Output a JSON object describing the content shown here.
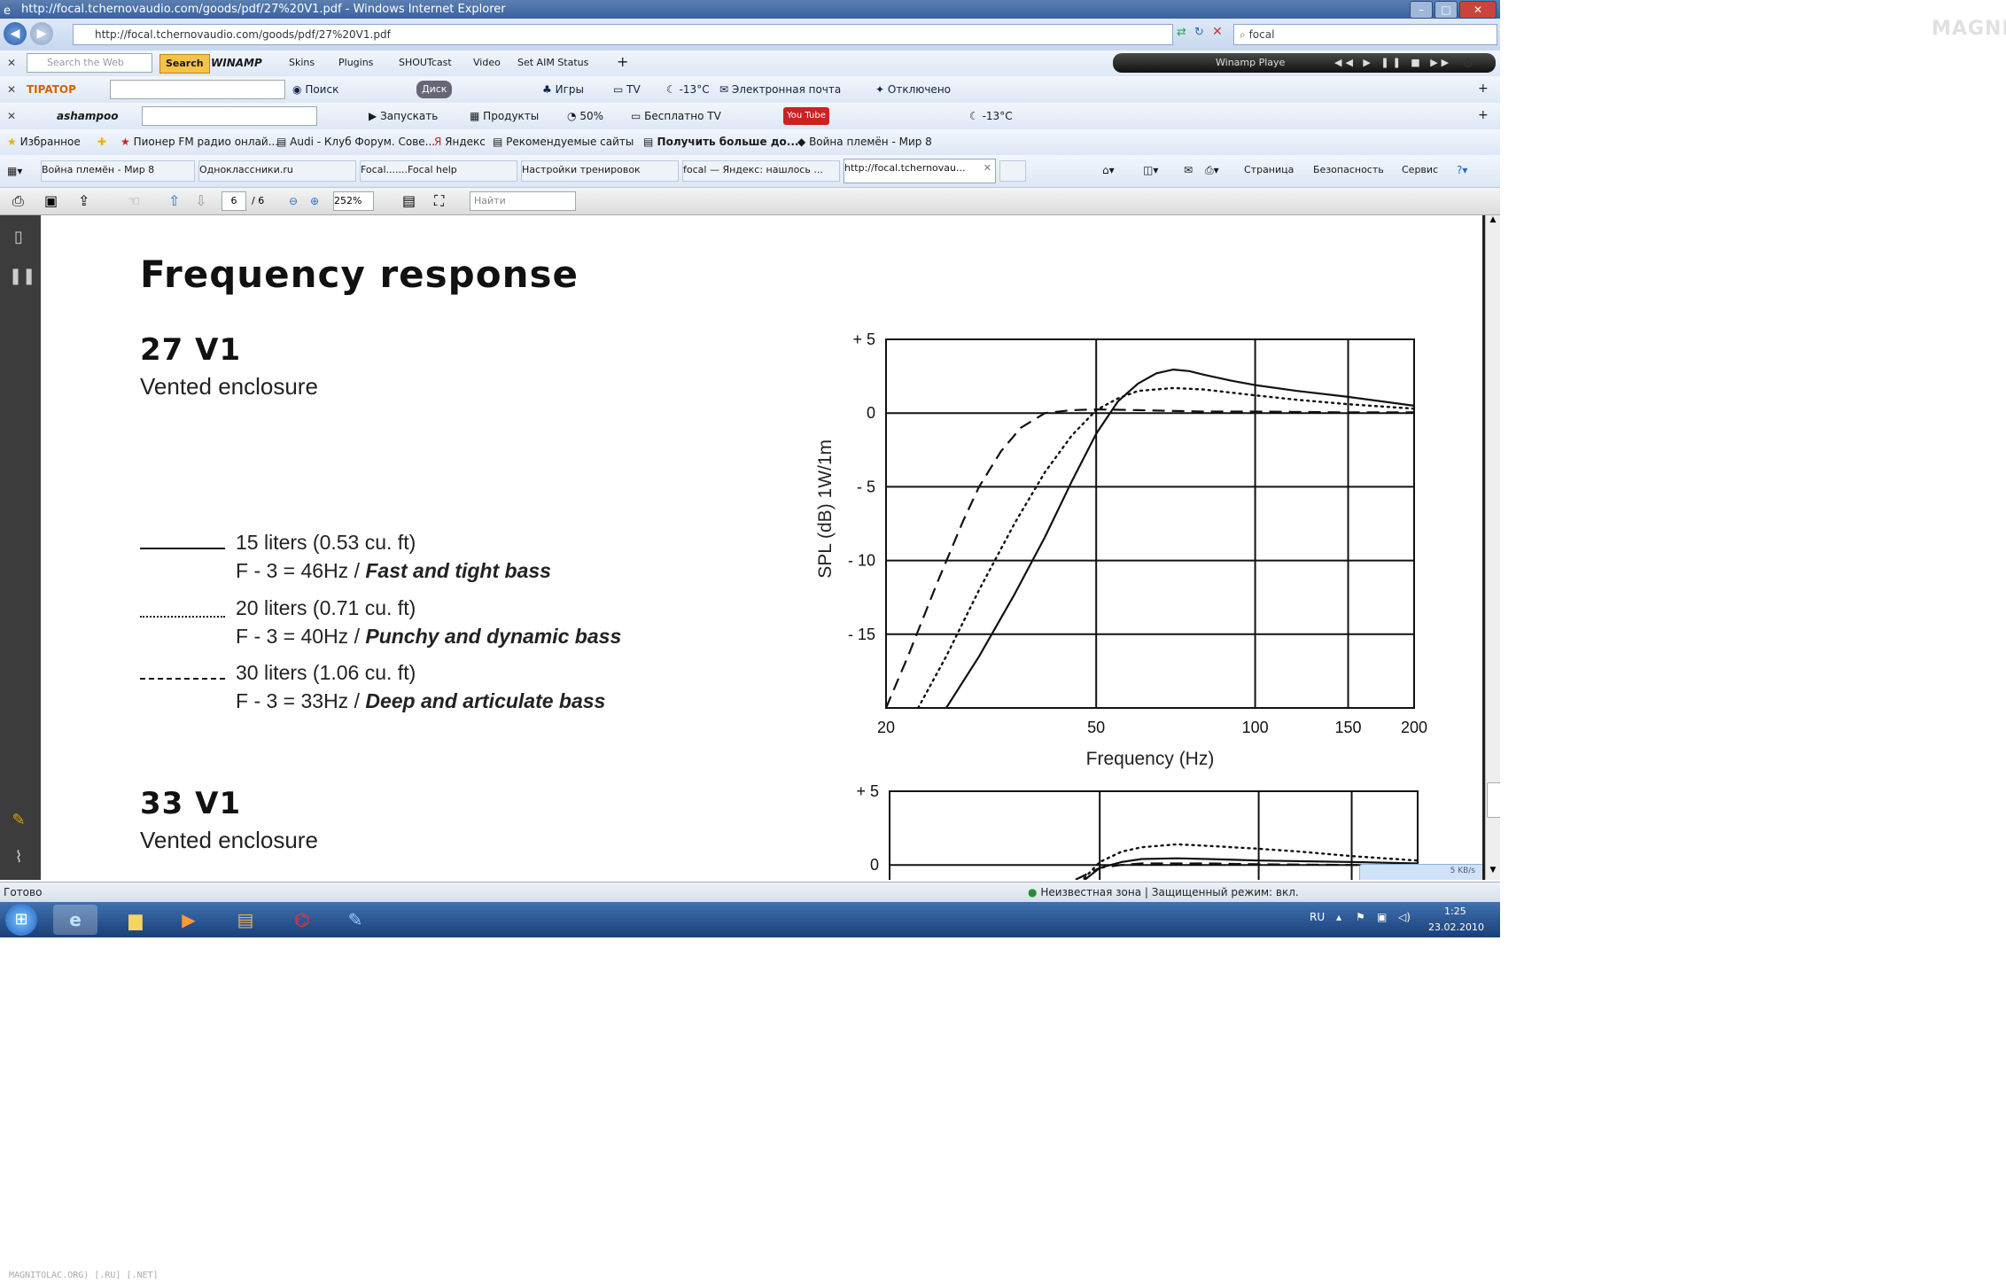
{
  "window": {
    "title": "http://focal.tchernovaudio.com/goods/pdf/27%20V1.pdf - Windows Internet Explorer"
  },
  "address": {
    "url": "http://focal.tchernovaudio.com/goods/pdf/27%20V1.pdf",
    "search": "focal"
  },
  "toolbar1": {
    "search_placeholder": "Search the Web",
    "search_button": "Search",
    "brand": "WINAMP",
    "items": [
      "Skins",
      "Plugins",
      "SHOUTcast",
      "Video",
      "Set AIM Status"
    ],
    "player": "Winamp Playe"
  },
  "toolbar2": {
    "brand": "TIPATOP",
    "search": "Поиск",
    "disk": "Диск",
    "games": "Игры",
    "tv": "TV",
    "weather": "-13°C",
    "mail": "Электронная почта",
    "status": "Отключено"
  },
  "toolbar3": {
    "brand": "ashampoo",
    "launch": "Запускать",
    "products": "Продукты",
    "percent": "50%",
    "free_tv": "Бесплатно TV",
    "weather": "-13°C"
  },
  "favorites": {
    "label": "Избранное",
    "items": [
      "Пионер FM радио онлай...",
      "Audi - Клуб Форум. Сове...",
      "Яндекс",
      "Рекомендуемые сайты",
      "Получить больше до...",
      "Война племён - Мир 8"
    ]
  },
  "tabs": {
    "items": [
      "Война племён - Мир 8",
      "Одноклассники.ru",
      "Focal.......Focal help",
      "Настройки тренировок",
      "focal — Яндекс: нашлось ...",
      "http://focal.tchernovau..."
    ],
    "right": [
      "Страница",
      "Безопасность",
      "Сервис"
    ]
  },
  "pdf_toolbar": {
    "page": "6",
    "pages": "/ 6",
    "zoom": "252%",
    "find_placeholder": "Найти"
  },
  "document": {
    "title": "Frequency response",
    "model1": "27 V1",
    "enclosure1": "Vented enclosure",
    "legend": [
      {
        "line1": "15 liters (0.53 cu. ft)",
        "line2_prefix": "F - 3 = 46Hz / ",
        "line2_em": "Fast and tight bass"
      },
      {
        "line1": "20 liters (0.71 cu. ft)",
        "line2_prefix": "F - 3 = 40Hz / ",
        "line2_em": "Punchy and dynamic bass"
      },
      {
        "line1": "30 liters (1.06 cu. ft)",
        "line2_prefix": "F - 3 = 33Hz / ",
        "line2_em": "Deep and articulate bass"
      }
    ],
    "model2": "33 V1",
    "enclosure2": "Vented enclosure"
  },
  "chart_data": [
    {
      "type": "line",
      "xlabel": "Frequency (Hz)",
      "ylabel": "SPL (dB) 1W/1m",
      "x_scale": "log",
      "xlim": [
        20,
        200
      ],
      "ylim": [
        -20,
        5
      ],
      "x_ticks": [
        "20",
        "50",
        "100",
        "150",
        "200"
      ],
      "y_ticks": [
        "+ 5",
        "0",
        "- 5",
        "- 10",
        "- 15"
      ],
      "x_tick_values": [
        20,
        50,
        100,
        150,
        200
      ],
      "y_tick_values": [
        5,
        0,
        -5,
        -10,
        -15
      ],
      "grid": true,
      "series": [
        {
          "style": "solid",
          "x": [
            26,
            30,
            35,
            40,
            45,
            50,
            55,
            60,
            65,
            70,
            75,
            80,
            90,
            100,
            120,
            150,
            200
          ],
          "y": [
            -20,
            -16.5,
            -12.3,
            -8.4,
            -4.6,
            -1.4,
            0.8,
            2.0,
            2.7,
            2.95,
            2.85,
            2.6,
            2.2,
            1.9,
            1.5,
            1.1,
            0.5
          ]
        },
        {
          "style": "dotted",
          "x": [
            23,
            26,
            30,
            35,
            40,
            45,
            50,
            55,
            60,
            70,
            80,
            100,
            120,
            150,
            200
          ],
          "y": [
            -20,
            -16.5,
            -12,
            -7.5,
            -4,
            -1.5,
            0.2,
            1.0,
            1.5,
            1.7,
            1.6,
            1.2,
            0.9,
            0.6,
            0.3
          ]
        },
        {
          "style": "dashed",
          "x": [
            20,
            22,
            25,
            28,
            30,
            33,
            36,
            40,
            45,
            50,
            60,
            80,
            100,
            150,
            200
          ],
          "y": [
            -20,
            -16.5,
            -11.5,
            -7.3,
            -5,
            -2.6,
            -1.0,
            0.0,
            0.2,
            0.25,
            0.2,
            0.1,
            0.1,
            0.05,
            0.05
          ]
        }
      ]
    },
    {
      "type": "line",
      "x_scale": "log",
      "xlim": [
        20,
        200
      ],
      "ylim": [
        -20,
        5
      ],
      "y_ticks": [
        "+ 5",
        "0"
      ],
      "y_tick_values": [
        5,
        0
      ],
      "grid": true,
      "series": [
        {
          "style": "dotted",
          "x": [
            45,
            50,
            55,
            60,
            70,
            80,
            100,
            120,
            150,
            200
          ],
          "y": [
            -1.5,
            0.2,
            0.9,
            1.2,
            1.4,
            1.3,
            1.1,
            0.9,
            0.6,
            0.3
          ]
        },
        {
          "style": "solid",
          "x": [
            45,
            50,
            55,
            60,
            70,
            80,
            100,
            150,
            200
          ],
          "y": [
            -1.5,
            -0.2,
            0.2,
            0.4,
            0.45,
            0.4,
            0.3,
            0.2,
            0.1
          ]
        },
        {
          "style": "dashed",
          "x": [
            45,
            50,
            55,
            60,
            70,
            80,
            100,
            150,
            200
          ],
          "y": [
            -1.0,
            -0.2,
            0.0,
            0.1,
            0.1,
            0.1,
            0.05,
            0.0,
            0.0
          ]
        }
      ]
    }
  ],
  "statusbar": {
    "left": "Готово",
    "zone": "Неизвестная зона | Защищенный режим: вкл.",
    "speed": "5 KB/s"
  },
  "taskbar": {
    "lang": "RU",
    "time": "1:25",
    "date": "23.02.2010"
  },
  "footer": {
    "text": "MAGNITOLAC.ORG) [.RU] [.NET]"
  },
  "colors": {
    "title_bar": "#3a62a0",
    "taskbar": "#1a3f77",
    "sidebar": "#3c3c3c"
  }
}
